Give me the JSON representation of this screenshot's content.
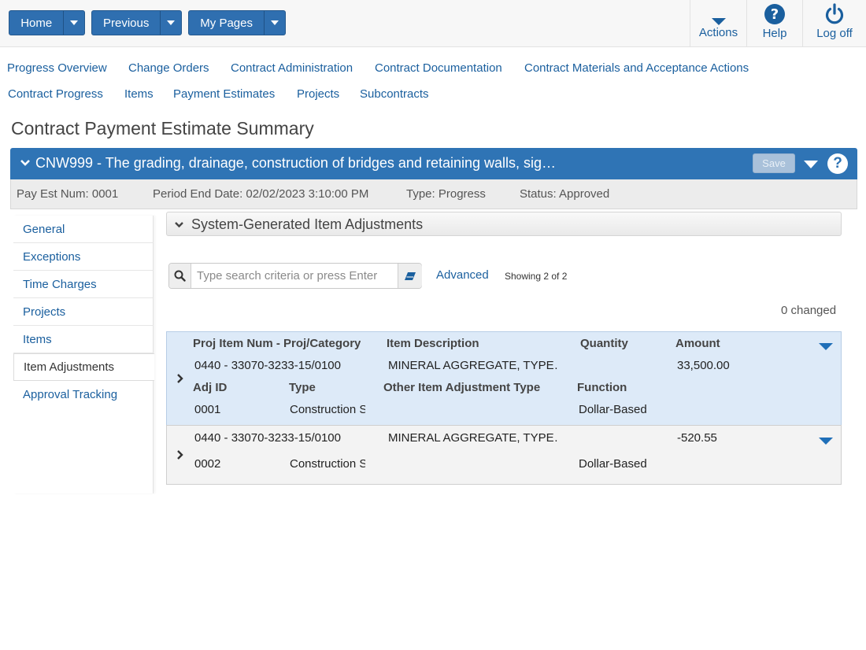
{
  "topnav": {
    "home": "Home",
    "previous": "Previous",
    "my_pages": "My Pages",
    "actions": "Actions",
    "help": "Help",
    "logoff": "Log off"
  },
  "links_row1": [
    "Progress Overview",
    "Change Orders",
    "Contract Administration",
    "Contract Documentation",
    "Contract Materials and Acceptance Actions"
  ],
  "links_row2": [
    "Contract Progress",
    "Items",
    "Payment Estimates",
    "Projects",
    "Subcontracts"
  ],
  "page_title": "Contract Payment Estimate Summary",
  "record": {
    "title": "CNW999 - The grading, drainage, construction of bridges and retaining walls, sig…",
    "save": "Save",
    "help_glyph": "?",
    "pay_est_num": "Pay Est Num: 0001",
    "period_end": "Period End Date: 02/02/2023 3:10:00 PM",
    "type": "Type: Progress",
    "status": "Status: Approved"
  },
  "sidebar": {
    "items": [
      {
        "label": "General"
      },
      {
        "label": "Exceptions"
      },
      {
        "label": "Time Charges"
      },
      {
        "label": "Projects"
      },
      {
        "label": "Items"
      },
      {
        "label": "Item Adjustments"
      },
      {
        "label": "Approval Tracking"
      }
    ],
    "active": "Item Adjustments"
  },
  "section": {
    "title": "System-Generated Item Adjustments",
    "search_placeholder": "Type search criteria or press Enter",
    "advanced": "Advanced",
    "showing": "Showing 2 of 2",
    "changed": "0 changed"
  },
  "grid": {
    "headers": {
      "proj_item": "Proj Item Num - Proj/Category",
      "item_desc": "Item Description",
      "quantity": "Quantity",
      "amount": "Amount",
      "adj_id": "Adj ID",
      "type": "Type",
      "other_type": "Other Item Adjustment Type",
      "function": "Function"
    },
    "rows": [
      {
        "proj_item": "0440 - 33070-3233-15/0100",
        "item_desc": "MINERAL AGGREGATE, TYPE…",
        "quantity": "",
        "amount": "33,500.00",
        "adj_id": "0001",
        "type": "Construction S",
        "other_type": "",
        "function": "Dollar-Based"
      },
      {
        "proj_item": "0440 - 33070-3233-15/0100",
        "item_desc": "MINERAL AGGREGATE, TYPE…",
        "quantity": "",
        "amount": "-520.55",
        "adj_id": "0002",
        "type": "Construction S",
        "other_type": "",
        "function": "Dollar-Based"
      }
    ]
  },
  "colors": {
    "brand_blue": "#2f74b5",
    "link_blue": "#1a5f9e",
    "selected_row": "#ddeaf8"
  }
}
